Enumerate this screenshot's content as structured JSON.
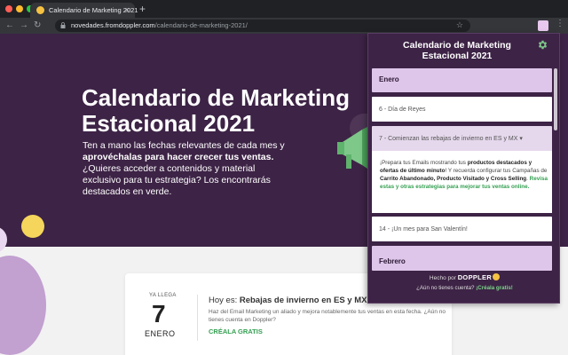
{
  "browser": {
    "tab_title": "Calendario de Marketing 2021",
    "tab_close": "×",
    "new_tab": "+",
    "url_host": "novedades.fromdoppler.com",
    "url_path": "/calendario-de-marketing-2021/",
    "icons": [
      "back-icon",
      "forward-icon",
      "reload-icon",
      "lock-icon",
      "star-icon",
      "extension-icon",
      "menu-icon"
    ]
  },
  "hero": {
    "title_line1": "Calendario de Marketing",
    "title_line2": "Estacional 2021",
    "text_part1": "Ten a mano las fechas relevantes de cada mes y ",
    "text_bold": "aprovéchalas para hacer crecer tus ventas.",
    "text_part2": " ¿Quieres acceder a contenidos y material exclusivo para tu estrategia? Los encontrarás destacados en verde."
  },
  "card": {
    "kicker": "YA LLEGA",
    "day": "7",
    "month": "ENERO",
    "today_prefix": "Hoy es: ",
    "today_event": "Rebajas de invierno en ES y MX",
    "description": "Haz del Email Marketing un aliado y mejora notablemente tus ventas en esta fecha. ¿Aún no tienes cuenta en Doppler?",
    "cta": "CRÉALA GRATIS"
  },
  "popup": {
    "title_line1": "Calendario de Marketing",
    "title_line2": "Estacional 2021",
    "items": [
      {
        "type": "month",
        "label": "Enero"
      },
      {
        "type": "event",
        "label": "6 - Día de Reyes"
      },
      {
        "type": "event-open",
        "label": "7 - Comienzan las rebajas de invierno en ES y MX ▾"
      },
      {
        "type": "event",
        "label": "14 - ¡Un mes para San Valentín!"
      },
      {
        "type": "month",
        "label": "Febrero"
      }
    ],
    "detail": {
      "p1": "¡Prepara tus Emails mostrando tus ",
      "b1": "productos destacados y ofertas de último minuto",
      "p2": "! Y recuerda configurar tus Campañas de ",
      "b2": "Carrito Abandonado, Producto Visitado y Cross Selling",
      "p3": ". ",
      "g1": "Revisa estas y otras estrategias para mejorar tus ventas online."
    },
    "footer": {
      "made_by": "Hecho por",
      "brand": "DOPPLER",
      "no_account": "¿Aún no tienes cuenta?",
      "create_free": "¡Créala gratis!"
    }
  },
  "colors": {
    "hero_bg": "#3d2346",
    "month_header_bg": "#ddc6ea",
    "accent_green": "#35a052",
    "accent_yellow": "#f5d55b"
  }
}
